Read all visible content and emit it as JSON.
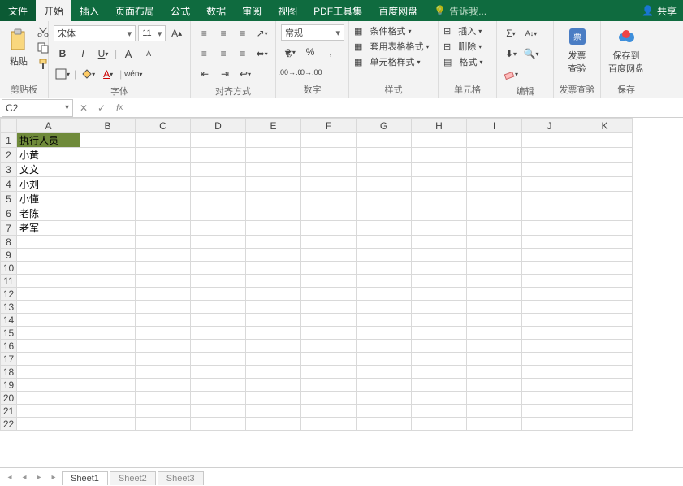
{
  "tabs": {
    "file": "文件",
    "home": "开始",
    "insert": "插入",
    "layout": "页面布局",
    "formula": "公式",
    "data": "数据",
    "review": "审阅",
    "view": "视图",
    "pdf": "PDF工具集",
    "baidu": "百度网盘",
    "tell": "告诉我...",
    "share": "共享"
  },
  "ribbon": {
    "clipboard": {
      "paste": "粘贴",
      "label": "剪贴板"
    },
    "font": {
      "name": "宋体",
      "size": "11",
      "label": "字体"
    },
    "align": {
      "label": "对齐方式"
    },
    "number": {
      "format": "常规",
      "label": "数字"
    },
    "styles": {
      "cond": "条件格式",
      "table": "套用表格格式",
      "cell": "单元格样式",
      "label": "样式"
    },
    "cells": {
      "insert": "插入",
      "delete": "删除",
      "format": "格式",
      "label": "单元格"
    },
    "edit": {
      "label": "编辑"
    },
    "invoice": {
      "btn": "发票\n查验",
      "label": "发票查验"
    },
    "save": {
      "btn": "保存到\n百度网盘",
      "label": "保存"
    }
  },
  "namebox": "C2",
  "columns": [
    "A",
    "B",
    "C",
    "D",
    "E",
    "F",
    "G",
    "H",
    "I",
    "J",
    "K"
  ],
  "rows": 22,
  "cells": {
    "A1": {
      "v": "执行人员",
      "hdr": true
    },
    "A2": {
      "v": "小黄"
    },
    "A3": {
      "v": "文文"
    },
    "A4": {
      "v": "小刘"
    },
    "A5": {
      "v": "小懂"
    },
    "A6": {
      "v": "老陈"
    },
    "A7": {
      "v": "老军"
    }
  },
  "sheets": {
    "s1": "Sheet1",
    "s2": "Sheet2",
    "s3": "Sheet3"
  }
}
